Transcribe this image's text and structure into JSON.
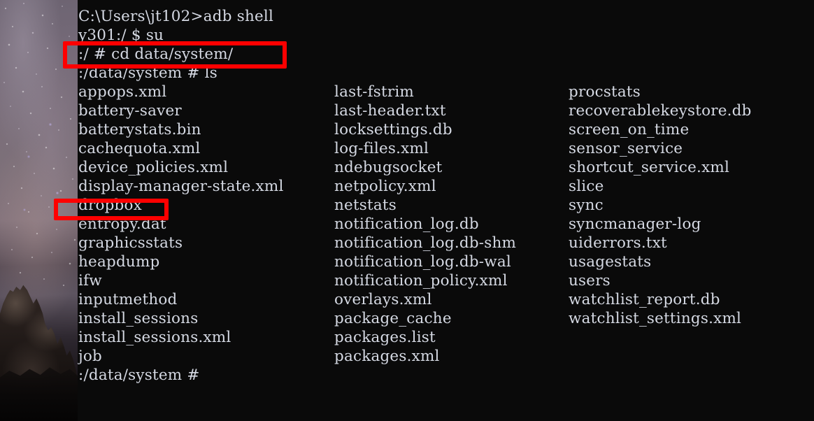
{
  "window": {
    "title": "adb shell — C:\\Users\\jt102",
    "background_color": "#0a0a0a",
    "text_color": "#d5d9e3"
  },
  "desktop": {
    "wallpaper_name": "milky-way-night-sky-rock-wallpaper"
  },
  "terminal": {
    "prompt_lines": [
      "C:\\Users\\jt102>adb shell",
      "y301:/ $ su",
      ":/ # cd data/system/",
      ":/data/system # ls"
    ],
    "line_windows_prompt": "C:\\Users\\jt102>adb shell",
    "line_su": "y301:/ $ su",
    "line_cd": ":/ # cd data/system/",
    "line_ls": ":/data/system # ls",
    "final_prompt": ":/data/system #",
    "commands": {
      "adb_shell": "adb shell",
      "su": "su",
      "cd": "cd data/system/",
      "ls": "ls"
    },
    "listing_rows": [
      {
        "col1": "appops.xml",
        "col2": "last-fstrim",
        "col3": "procstats"
      },
      {
        "col1": "battery-saver",
        "col2": "last-header.txt",
        "col3": "recoverablekeystore.db"
      },
      {
        "col1": "batterystats.bin",
        "col2": "locksettings.db",
        "col3": "screen_on_time"
      },
      {
        "col1": "cachequota.xml",
        "col2": "log-files.xml",
        "col3": "sensor_service"
      },
      {
        "col1": "device_policies.xml",
        "col2": "ndebugsocket",
        "col3": "shortcut_service.xml"
      },
      {
        "col1": "display-manager-state.xml",
        "col2": "netpolicy.xml",
        "col3": "slice"
      },
      {
        "col1": "dropbox",
        "col2": "netstats",
        "col3": "sync"
      },
      {
        "col1": "entropy.dat",
        "col2": "notification_log.db",
        "col3": "syncmanager-log"
      },
      {
        "col1": "graphicsstats",
        "col2": "notification_log.db-shm",
        "col3": "uiderrors.txt"
      },
      {
        "col1": "heapdump",
        "col2": "notification_log.db-wal",
        "col3": "usagestats"
      },
      {
        "col1": "ifw",
        "col2": "notification_policy.xml",
        "col3": "users"
      },
      {
        "col1": "inputmethod",
        "col2": "overlays.xml",
        "col3": "watchlist_report.db"
      },
      {
        "col1": "install_sessions",
        "col2": "package_cache",
        "col3": "watchlist_settings.xml"
      },
      {
        "col1": "install_sessions.xml",
        "col2": "packages.list",
        "col3": ""
      },
      {
        "col1": "job",
        "col2": "packages.xml",
        "col3": ""
      }
    ]
  },
  "annotations": {
    "color": "#fe0000",
    "boxes": [
      {
        "name": "cd-command-highlight",
        "label": ":/ # cd data/system/"
      },
      {
        "name": "dropbox-entry-highlight",
        "label": "dropbox"
      }
    ]
  }
}
